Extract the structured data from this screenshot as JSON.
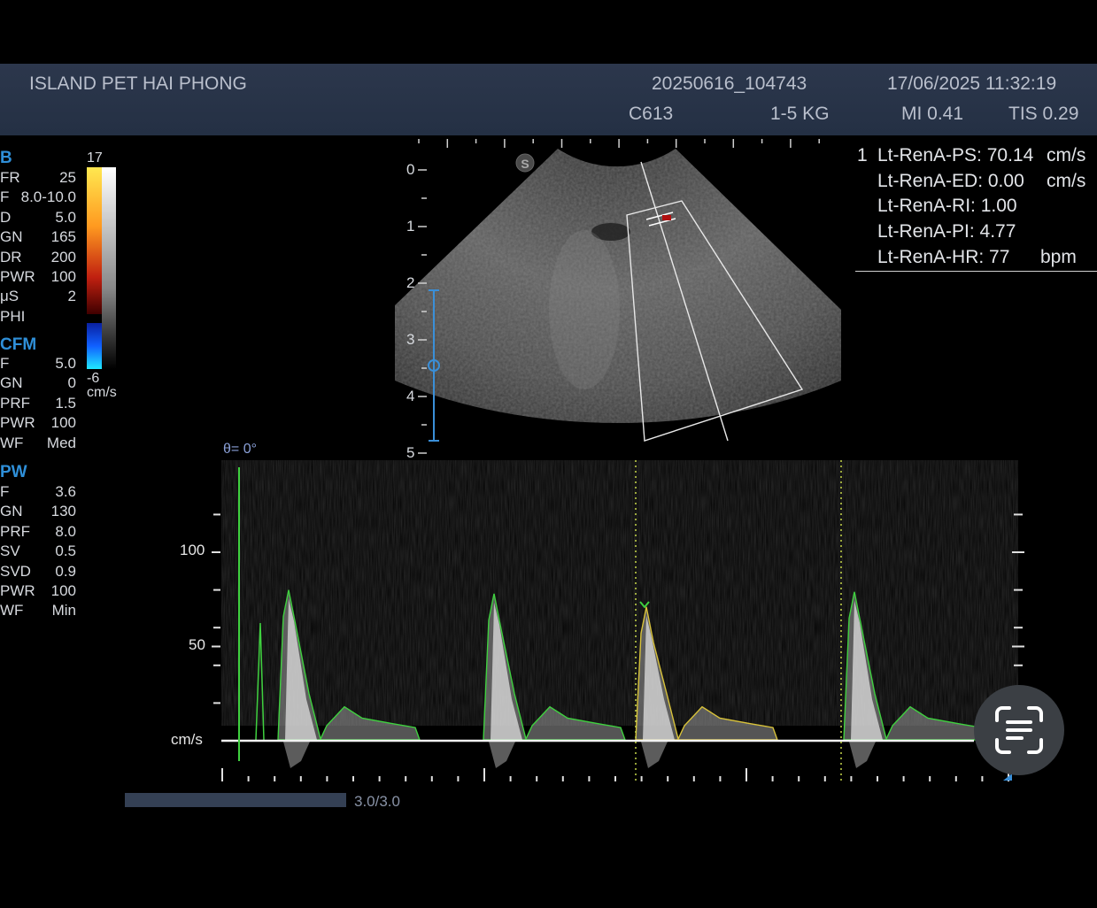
{
  "header": {
    "clinic": "ISLAND PET HAI PHONG",
    "exam_id": "20250616_104743",
    "datetime": "17/06/2025 11:32:19",
    "probe": "C613",
    "weight": "1-5 KG",
    "mi": "MI 0.41",
    "tis": "TIS 0.29"
  },
  "b_mode": {
    "title": "B",
    "params": [
      {
        "k": "FR",
        "v": "25"
      },
      {
        "k": "F",
        "v": "8.0-10.0"
      },
      {
        "k": "D",
        "v": "5.0"
      },
      {
        "k": "GN",
        "v": "165"
      },
      {
        "k": "DR",
        "v": "200"
      },
      {
        "k": "PWR",
        "v": "100"
      },
      {
        "k": "μS",
        "v": "2"
      },
      {
        "k": "PHI",
        "v": ""
      }
    ]
  },
  "cfm": {
    "title": "CFM",
    "params": [
      {
        "k": "F",
        "v": "5.0"
      },
      {
        "k": "GN",
        "v": "0"
      },
      {
        "k": "PRF",
        "v": "1.5"
      },
      {
        "k": "PWR",
        "v": "100"
      },
      {
        "k": "WF",
        "v": "Med"
      }
    ]
  },
  "pw": {
    "title": "PW",
    "params": [
      {
        "k": "F",
        "v": "3.6"
      },
      {
        "k": "GN",
        "v": "130"
      },
      {
        "k": "PRF",
        "v": "8.0"
      },
      {
        "k": "SV",
        "v": "0.5"
      },
      {
        "k": "SVD",
        "v": "0.9"
      },
      {
        "k": "PWR",
        "v": "100"
      },
      {
        "k": "WF",
        "v": "Min"
      }
    ]
  },
  "colorbar": {
    "top": "17",
    "bottom": "-6",
    "unit": "cm/s"
  },
  "measurements": {
    "index": "1",
    "rows": [
      {
        "label": "Lt-RenA-PS: 70.14",
        "unit": "cm/s"
      },
      {
        "label": "Lt-RenA-ED: 0.00",
        "unit": "cm/s"
      },
      {
        "label": "Lt-RenA-RI: 1.00",
        "unit": ""
      },
      {
        "label": "Lt-RenA-PI: 4.77",
        "unit": ""
      },
      {
        "label": "Lt-RenA-HR: 77",
        "unit": "bpm"
      }
    ]
  },
  "depth_scale": [
    "0",
    "1",
    "2",
    "3",
    "4",
    "5"
  ],
  "sector_badge": "S",
  "doppler": {
    "angle": "θ= 0°",
    "y_labels": [
      "100",
      "50",
      "cm/s"
    ],
    "peak_velocities_cm_s": [
      80,
      78,
      71,
      79
    ]
  },
  "cine": {
    "label": "3.0/3.0",
    "progress": 1.0
  },
  "colors": {
    "accent": "#2f8fd8",
    "trace_green": "#3fd13f",
    "trace_yellow": "#d8c23a",
    "header_bg": "#2c374c"
  },
  "icons": {
    "scan_button": "text-scan-icon"
  }
}
